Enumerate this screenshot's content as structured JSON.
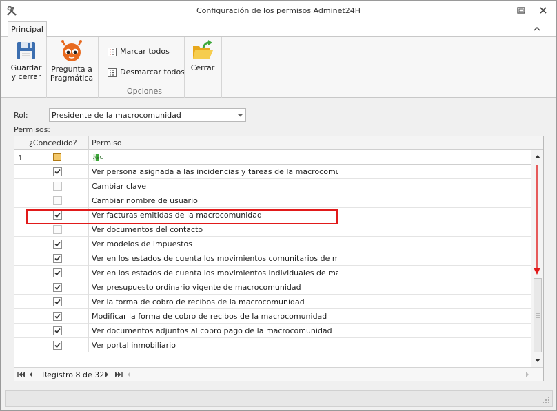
{
  "window": {
    "title": "Configuración de los permisos Adminet24H"
  },
  "ribbon": {
    "tab": "Principal",
    "buttons": {
      "save_l1": "Guardar",
      "save_l2": "y cerrar",
      "ask_l1": "Pregunta a",
      "ask_l2": "Pragmática",
      "close": "Cerrar"
    },
    "options": {
      "mark_all": "Marcar todos",
      "unmark_all": "Desmarcar todos",
      "group_label": "Opciones"
    }
  },
  "form": {
    "rol_label": "Rol:",
    "rol_value": "Presidente de la macrocomunidad",
    "permisos_label": "Permisos:"
  },
  "grid": {
    "columns": {
      "granted": "¿Concedido?",
      "permission": "Permiso"
    },
    "filter_abc": "ABC",
    "rows": [
      {
        "granted": true,
        "text": "Ver persona asignada a las incidencias y tareas de la macrocomunidad"
      },
      {
        "granted": false,
        "text": "Cambiar clave"
      },
      {
        "granted": false,
        "text": "Cambiar nombre de usuario"
      },
      {
        "granted": true,
        "text": "Ver facturas emitidas de la macrocomunidad"
      },
      {
        "granted": false,
        "text": "Ver documentos del contacto"
      },
      {
        "granted": true,
        "text": "Ver modelos de impuestos"
      },
      {
        "granted": true,
        "text": "Ver en los estados de cuenta los movimientos comunitarios de macroco..."
      },
      {
        "granted": true,
        "text": "Ver en los estados de cuenta los movimientos individuales de macrocom..."
      },
      {
        "granted": true,
        "text": "Ver presupuesto ordinario vigente de macrocomunidad"
      },
      {
        "granted": true,
        "text": "Ver la forma de cobro de recibos de la macrocomunidad"
      },
      {
        "granted": true,
        "text": "Modificar la forma de cobro de recibos de la macrocomunidad"
      },
      {
        "granted": true,
        "text": "Ver documentos adjuntos al cobro pago de la macrocomunidad"
      },
      {
        "granted": true,
        "text": "Ver portal inmobiliario"
      }
    ],
    "navigator": "Registro 8 de 32"
  },
  "colors": {
    "highlight": "#e11a1a",
    "accent": "#e86a1f"
  }
}
